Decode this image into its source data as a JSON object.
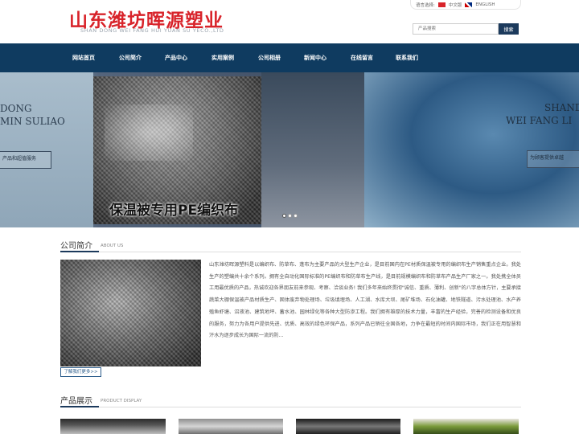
{
  "header": {
    "company_name": "山东潍坊晖源塑业",
    "company_name_en": "SHAN DONG WEI FANG HUI YUAN SU YECO.,LTD",
    "lang_label": "语言选择:",
    "lang_cn": "中文版",
    "lang_en": "ENGLISH",
    "search_placeholder": "产品搜索",
    "search_button": "搜索"
  },
  "nav": {
    "items": [
      "网站首页",
      "公司简介",
      "产品中心",
      "实用案例",
      "公司相册",
      "新闻中心",
      "在线留言",
      "联系我们"
    ]
  },
  "banner": {
    "caption": "保温被专用PE编织布",
    "left_line1": "DONG",
    "left_line2": "MIN SULIAO",
    "left_box": "产品和超值服务",
    "right_line1": "SHAND",
    "right_line2": "WEI FANG LI",
    "right_box": "为顾客提供卓越",
    "slides_count": 3,
    "active_slide": 1
  },
  "about": {
    "title": "公司简介",
    "subtitle": "ABOUT US",
    "text": "山东潍坊晖源塑料是以编织布、防草布、蓬布为主要产品的大型生产企业，是目前国内在PE材质保温被专用的编织布生产销售重点企业。我处生产的塑编共十余个系列。拥有全自动化国际标准的PE编织布和防草布生产线，是目前规模编织布和防草布产品生产厂家之一。我处携全体员工用最优质的产品，热诚欢迎各界朋友前来参观、考察、洽谈业务! 我们多年来始终贯彻\"诚信、重质、薄利、创新\"的八字总体方针，主要承接蔬菜大棚保温被产品材质生产、固体废弃物处理场、垃圾填埋场、人工湖、水库大坝、尾矿堆场、石化油罐、地铁隧道、污水处理池、水产养殖鱼虾塘、沼液池、建筑地坪、蓄水池、园林绿化等各种大型防渗工程。我们拥有雄厚的技术力量，丰富的生产经验，完善的检测设备和优良的服务，努力为各用户提供先进、优质、高效的绿色环保产品，系列产品已销往全国各地，力争在最短的时间内国际市场，我们正在用智慧和汗水为逐步成长为国际一流的防...",
    "more_button": "了解我们更多>>"
  },
  "products": {
    "title": "产品展示",
    "subtitle": "PRODUCT DISPLAY"
  }
}
